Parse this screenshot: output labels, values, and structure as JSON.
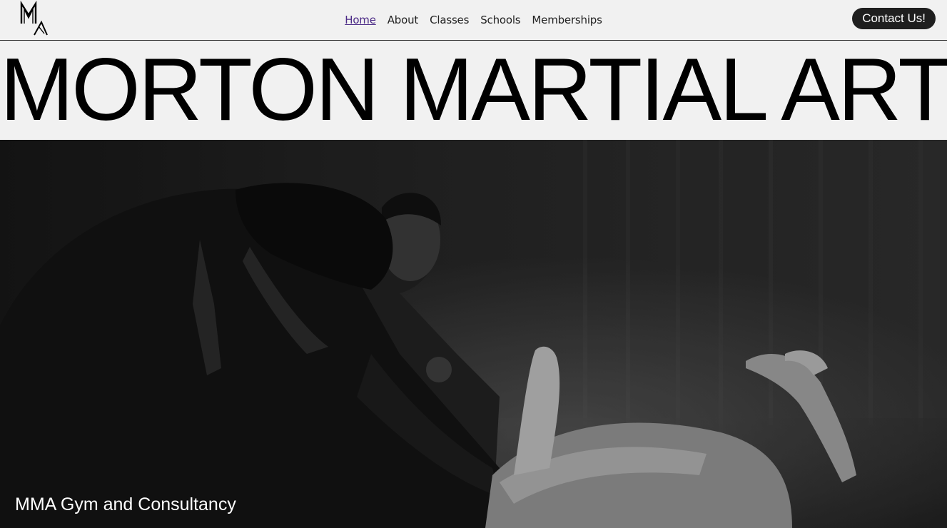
{
  "nav": {
    "items": [
      {
        "label": "Home",
        "active": true
      },
      {
        "label": "About",
        "active": false
      },
      {
        "label": "Classes",
        "active": false
      },
      {
        "label": "Schools",
        "active": false
      },
      {
        "label": "Memberships",
        "active": false
      }
    ],
    "contact_label": "Contact Us!"
  },
  "header": {
    "logo_icon": "mm-logo-icon",
    "title": "MORTON MARTIAL ARTS"
  },
  "hero": {
    "image": "martial-arts-sparring-photo",
    "tagline": "MMA Gym and Consultancy"
  },
  "colors": {
    "background": "#f1f1f1",
    "text": "#000000",
    "active_link": "#4b2a86",
    "button": "#1f1f1f",
    "button_text": "#ffffff"
  }
}
